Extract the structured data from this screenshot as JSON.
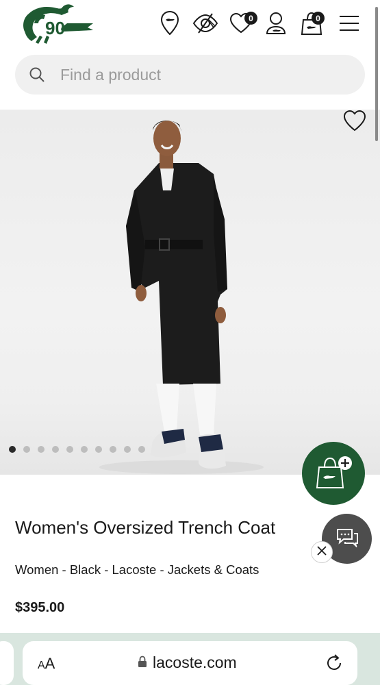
{
  "header": {
    "icons": [
      "croc-logo",
      "store-locator-icon",
      "visually-impaired-icon",
      "wishlist-icon",
      "account-icon",
      "cart-icon",
      "menu-icon"
    ],
    "wishlist_count": "0",
    "cart_count": "0",
    "logo_wordmark": "90"
  },
  "search": {
    "placeholder": "Find a product"
  },
  "gallery": {
    "slide_count": 10,
    "active_slide": 1
  },
  "product": {
    "title": "Women's Oversized Trench Coat",
    "breadcrumb": "Women - Black - Lacoste - Jackets & Coats",
    "price": "$395.00"
  },
  "browser": {
    "aa_label_small": "A",
    "aa_label_large": "A",
    "url": "lacoste.com"
  },
  "colors": {
    "brand_green": "#1f5a32",
    "chat_grey": "#4d4d4d",
    "browser_bar": "#d9e6df"
  }
}
